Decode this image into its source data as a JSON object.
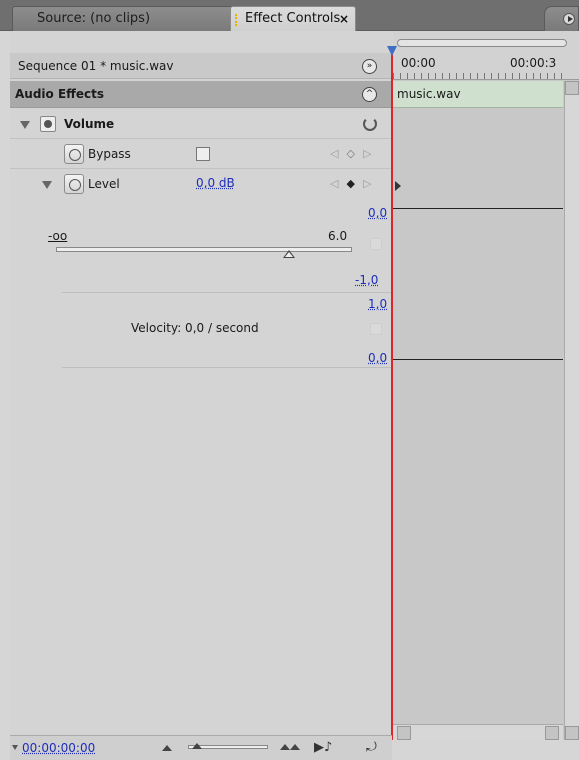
{
  "tabs": {
    "source": "Source: (no clips)",
    "effect_controls": "Effect Controls",
    "close": "×"
  },
  "sequence": {
    "label": "Sequence 01 * music.wav",
    "button": "»"
  },
  "audio_effects": {
    "label": "Audio Effects",
    "button": "^"
  },
  "volume": {
    "label": "Volume"
  },
  "bypass": {
    "label": "Bypass"
  },
  "level": {
    "label": "Level",
    "value": "0,0 dB",
    "graph_top": "0,0",
    "slider_min": "-oo",
    "slider_max": "6.0",
    "graph_bottom": "-1,0"
  },
  "velocity": {
    "label": "Velocity: 0,0 / second",
    "top": "1,0",
    "bottom": "0,0"
  },
  "timeline": {
    "start": "00:00",
    "end": "00:00:3",
    "clip": "music.wav"
  },
  "bottom_bar": {
    "timecode": "00:00:00:00"
  }
}
